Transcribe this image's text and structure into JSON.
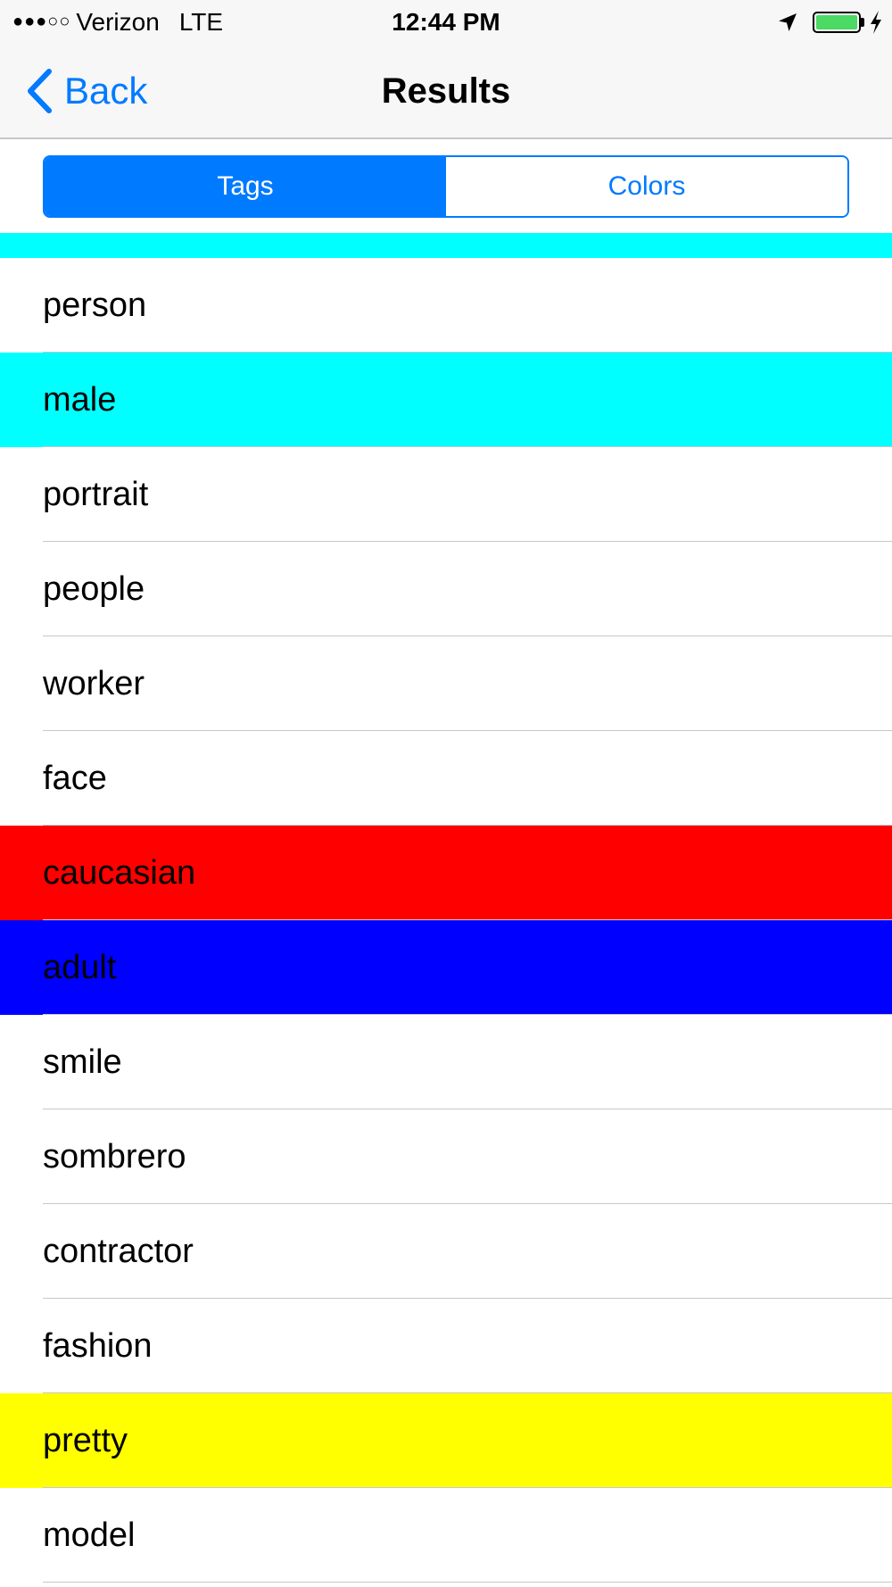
{
  "status_bar": {
    "signal": "●●●○○",
    "carrier": "Verizon",
    "network": "LTE",
    "time": "12:44 PM",
    "location_icon": "location-arrow-icon",
    "battery_icon": "battery-icon",
    "battery_level": 1.0,
    "battery_color": "#4cd964",
    "charging_icon": "bolt-icon"
  },
  "nav": {
    "back_label": "Back",
    "back_icon": "chevron-left-icon",
    "title": "Results",
    "accent_color": "#007aff"
  },
  "segments": [
    {
      "label": "Tags",
      "selected": true
    },
    {
      "label": "Colors",
      "selected": false
    }
  ],
  "list_top_color": "#00ffff",
  "tags": [
    {
      "label": "person",
      "color": "#ffffff"
    },
    {
      "label": "male",
      "color": "#00ffff"
    },
    {
      "label": "portrait",
      "color": "#ffffff"
    },
    {
      "label": "people",
      "color": "#ffffff"
    },
    {
      "label": "worker",
      "color": "#ffffff"
    },
    {
      "label": "face",
      "color": "#ffffff"
    },
    {
      "label": "caucasian",
      "color": "#ff0000"
    },
    {
      "label": "adult",
      "color": "#0000ff"
    },
    {
      "label": "smile",
      "color": "#ffffff"
    },
    {
      "label": "sombrero",
      "color": "#ffffff"
    },
    {
      "label": "contractor",
      "color": "#ffffff"
    },
    {
      "label": "fashion",
      "color": "#ffffff"
    },
    {
      "label": "pretty",
      "color": "#ffff00"
    },
    {
      "label": "model",
      "color": "#ffffff"
    }
  ]
}
